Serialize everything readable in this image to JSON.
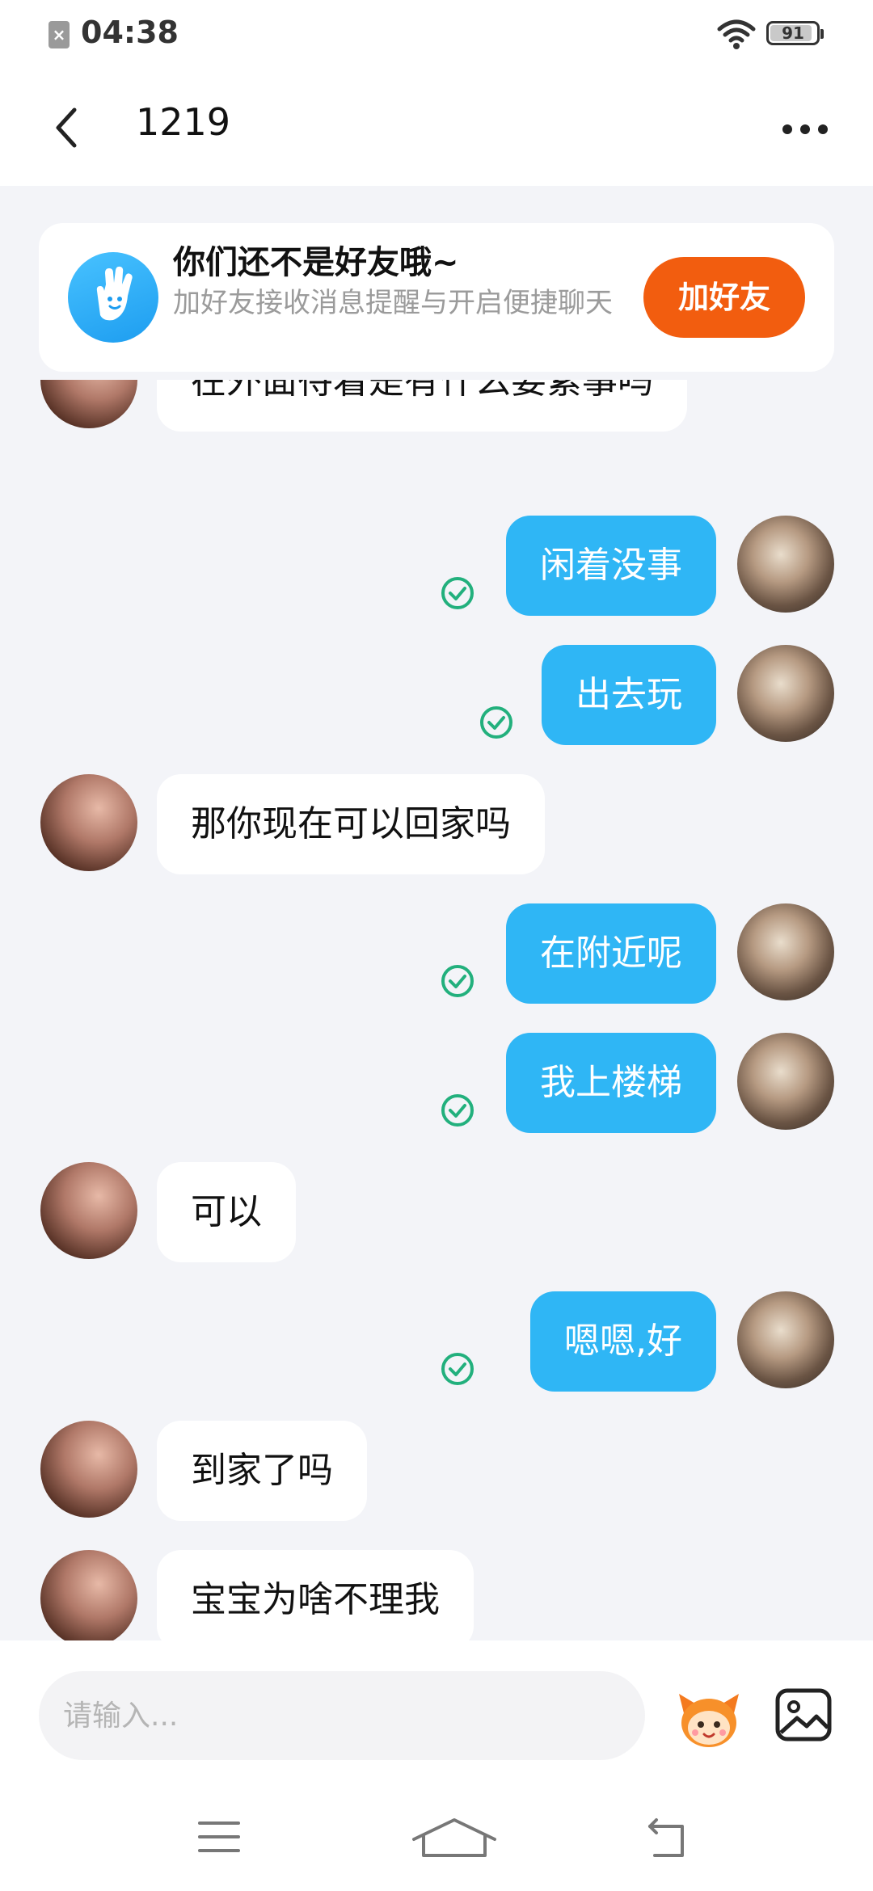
{
  "status_bar": {
    "time": "04:38",
    "battery": "91",
    "battery_level": 0.91
  },
  "header": {
    "title": "1219"
  },
  "friend_banner": {
    "title": "你们还不是好友哦~",
    "subtitle": "加好友接收消息提醒与开启便捷聊天",
    "button_label": "加好友"
  },
  "messages": [
    {
      "side": "in",
      "text": "在外面待着是有什么要紧事吗"
    },
    {
      "side": "out",
      "text": "闲着没事",
      "read": true
    },
    {
      "side": "out",
      "text": "出去玩",
      "read": true
    },
    {
      "side": "in",
      "text": "那你现在可以回家吗"
    },
    {
      "side": "out",
      "text": "在附近呢",
      "read": true
    },
    {
      "side": "out",
      "text": "我上楼梯",
      "read": true
    },
    {
      "side": "in",
      "text": "可以"
    },
    {
      "side": "out",
      "text": "嗯嗯,好",
      "read": true
    },
    {
      "side": "in",
      "text": "到家了吗"
    },
    {
      "side": "in",
      "text": "宝宝为啥不理我"
    }
  ],
  "input_bar": {
    "placeholder": "请输入..."
  },
  "colors": {
    "accent_orange": "#f25d0f",
    "bubble_out": "#2fb6f5",
    "read_check": "#22b07d",
    "background": "#f3f4f8"
  },
  "icons": [
    "back-icon",
    "more-icon",
    "hand-logo-icon",
    "read-check-icon",
    "emoji-icon",
    "image-icon",
    "menu-icon",
    "home-icon",
    "back-nav-icon"
  ]
}
